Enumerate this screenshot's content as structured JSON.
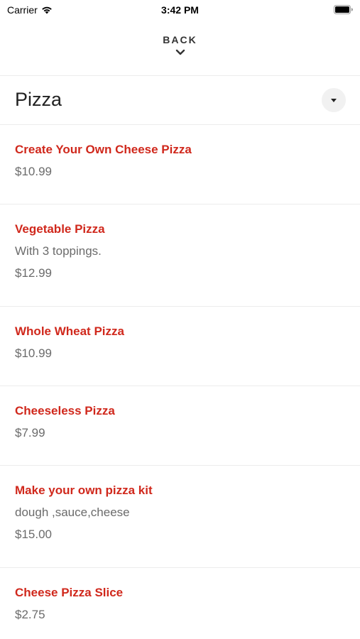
{
  "status_bar": {
    "carrier": "Carrier",
    "time": "3:42 PM"
  },
  "header": {
    "back_label": "BACK"
  },
  "category": {
    "title": "Pizza"
  },
  "menu_items": [
    {
      "name": "Create Your Own Cheese Pizza",
      "description": "",
      "price": "$10.99"
    },
    {
      "name": "Vegetable Pizza",
      "description": "With 3 toppings.",
      "price": "$12.99"
    },
    {
      "name": "Whole Wheat Pizza",
      "description": "",
      "price": "$10.99"
    },
    {
      "name": "Cheeseless Pizza",
      "description": "",
      "price": "$7.99"
    },
    {
      "name": "Make your own pizza kit",
      "description": "dough ,sauce,cheese",
      "price": "$15.00"
    },
    {
      "name": "Cheese Pizza Slice",
      "description": "",
      "price": "$2.75"
    }
  ],
  "colors": {
    "item_name": "#d0281c",
    "secondary_text": "#6b6b6b",
    "divider": "#ececec"
  },
  "icons": {
    "wifi": "wifi-icon",
    "battery": "battery-icon",
    "back": "chevron-down-icon",
    "dropdown": "caret-down-icon"
  }
}
